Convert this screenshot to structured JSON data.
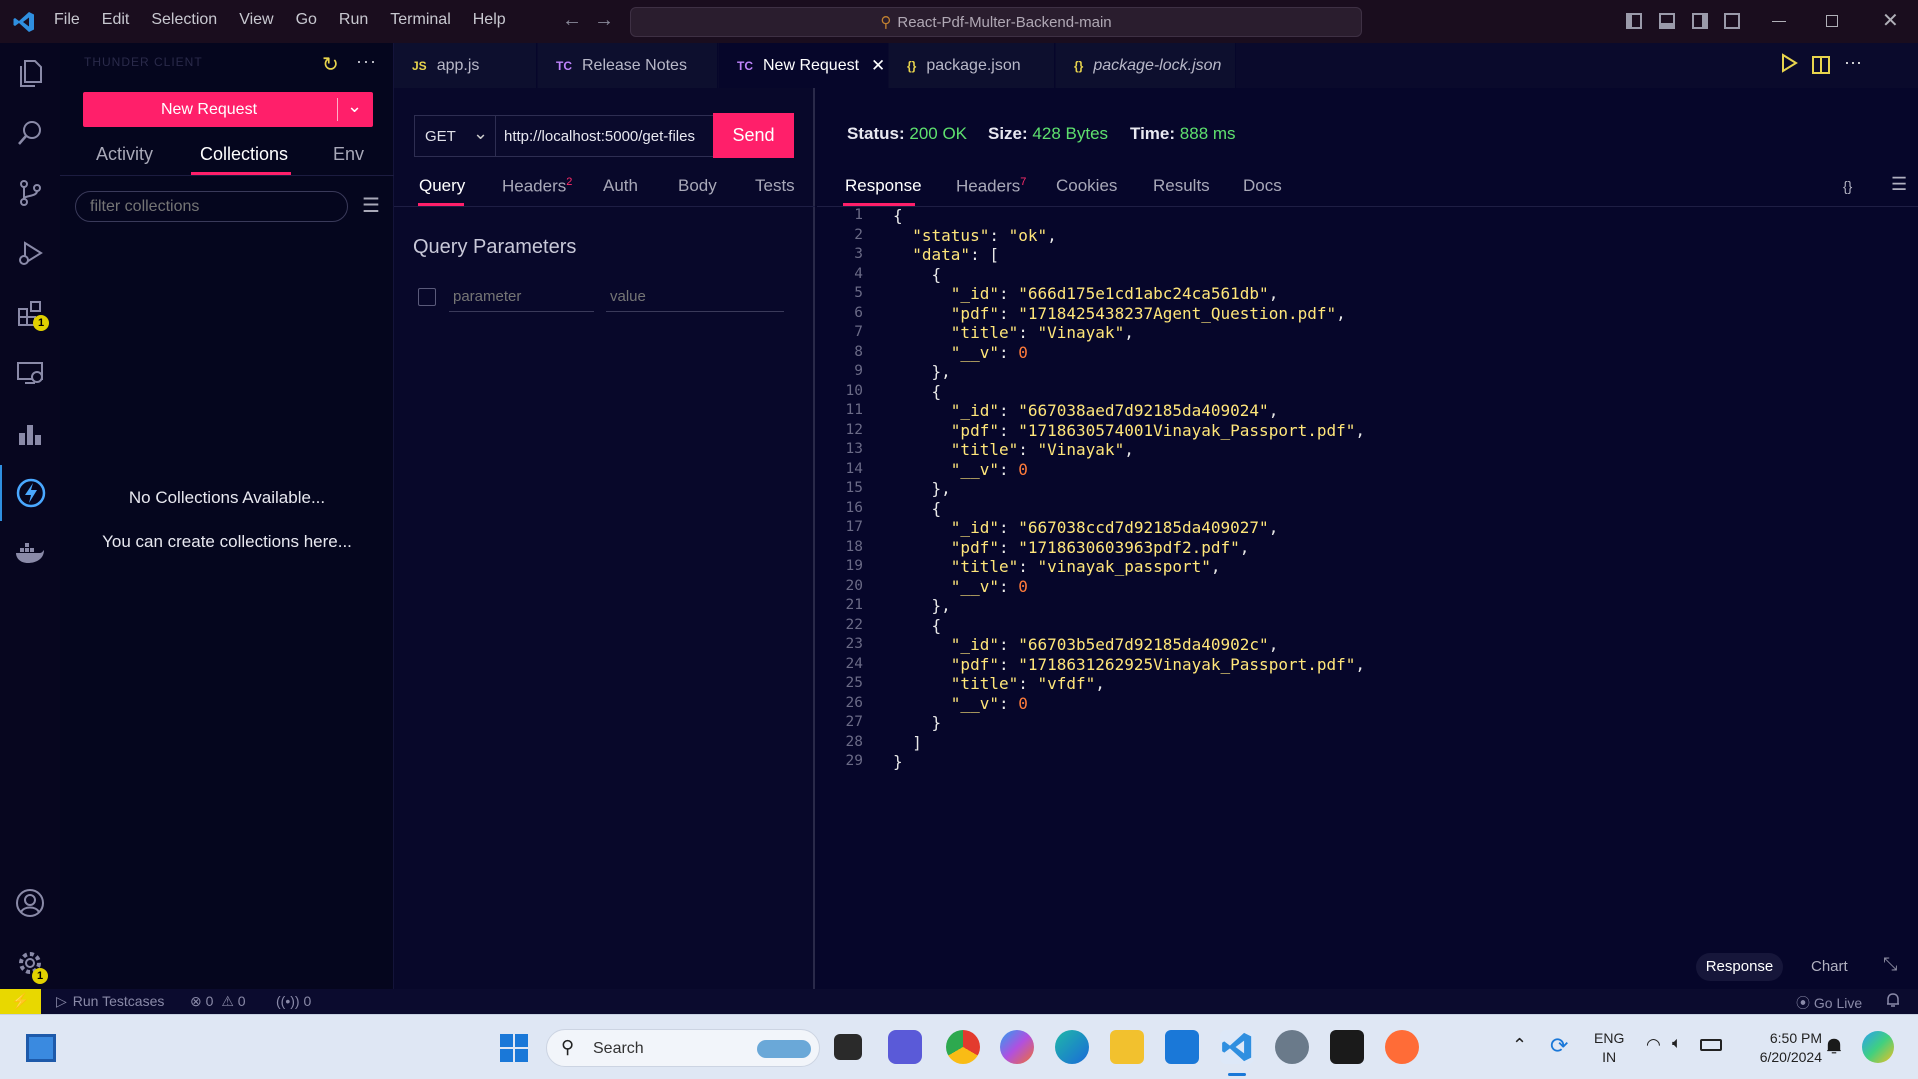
{
  "titlebar": {
    "menu": [
      "File",
      "Edit",
      "Selection",
      "View",
      "Go",
      "Run",
      "Terminal",
      "Help"
    ],
    "search_text": "React-Pdf-Multer-Backend-main"
  },
  "activity_badges": {
    "extensions": "1",
    "settings": "1"
  },
  "sidebar": {
    "header": "THUNDER CLIENT",
    "new_request": "New Request",
    "tabs": [
      "Activity",
      "Collections",
      "Env"
    ],
    "active_tab": "Collections",
    "filter_placeholder": "filter collections",
    "empty_title": "No Collections Available...",
    "empty_sub": "You can create collections here..."
  },
  "tabs": [
    {
      "icon": "JS",
      "label": "app.js",
      "icon_color": "#e8d44d"
    },
    {
      "icon": "TC",
      "label": "Release Notes",
      "icon_color": "#c084fc"
    },
    {
      "icon": "TC",
      "label": "New Request",
      "icon_color": "#c084fc"
    },
    {
      "icon": "{}",
      "label": "package.json",
      "icon_color": "#e8d44d"
    },
    {
      "icon": "{}",
      "label": "package-lock.json",
      "icon_color": "#e8d44d"
    }
  ],
  "request": {
    "method": "GET",
    "url": "http://localhost:5000/get-files",
    "send": "Send",
    "tabs": [
      "Query",
      "Headers",
      "Auth",
      "Body",
      "Tests"
    ],
    "headers_count": "2",
    "query_title": "Query Parameters",
    "param_placeholder": "parameter",
    "value_placeholder": "value"
  },
  "response": {
    "status_label": "Status:",
    "status_value": "200 OK",
    "size_label": "Size:",
    "size_value": "428 Bytes",
    "time_label": "Time:",
    "time_value": "888 ms",
    "tabs": [
      "Response",
      "Headers",
      "Cookies",
      "Results",
      "Docs"
    ],
    "headers_count": "7",
    "format_icon": "{}",
    "bottom_buttons": [
      "Response",
      "Chart"
    ]
  },
  "code_lines": [
    "{",
    "  \"status\": \"ok\",",
    "  \"data\": [",
    "    {",
    "      \"_id\": \"666d175e1cd1abc24ca561db\",",
    "      \"pdf\": \"1718425438237Agent_Question.pdf\",",
    "      \"title\": \"Vinayak\",",
    "      \"__v\": 0",
    "    },",
    "    {",
    "      \"_id\": \"667038aed7d92185da409024\",",
    "      \"pdf\": \"1718630574001Vinayak_Passport.pdf\",",
    "      \"title\": \"Vinayak\",",
    "      \"__v\": 0",
    "    },",
    "    {",
    "      \"_id\": \"667038ccd7d92185da409027\",",
    "      \"pdf\": \"1718630603963pdf2.pdf\",",
    "      \"title\": \"vinayak_passport\",",
    "      \"__v\": 0",
    "    },",
    "    {",
    "      \"_id\": \"66703b5ed7d92185da40902c\",",
    "      \"pdf\": \"1718631262925Vinayak_Passport.pdf\",",
    "      \"title\": \"vfdf\",",
    "      \"__v\": 0",
    "    }",
    "  ]",
    "}"
  ],
  "statusbar": {
    "run_testcases": "Run Testcases",
    "errors": "0",
    "warnings": "0",
    "ports": "0",
    "go_live": "Go Live"
  },
  "taskbar": {
    "search": "Search",
    "lang1": "ENG",
    "lang2": "IN",
    "time": "6:50 PM",
    "date": "6/20/2024"
  }
}
